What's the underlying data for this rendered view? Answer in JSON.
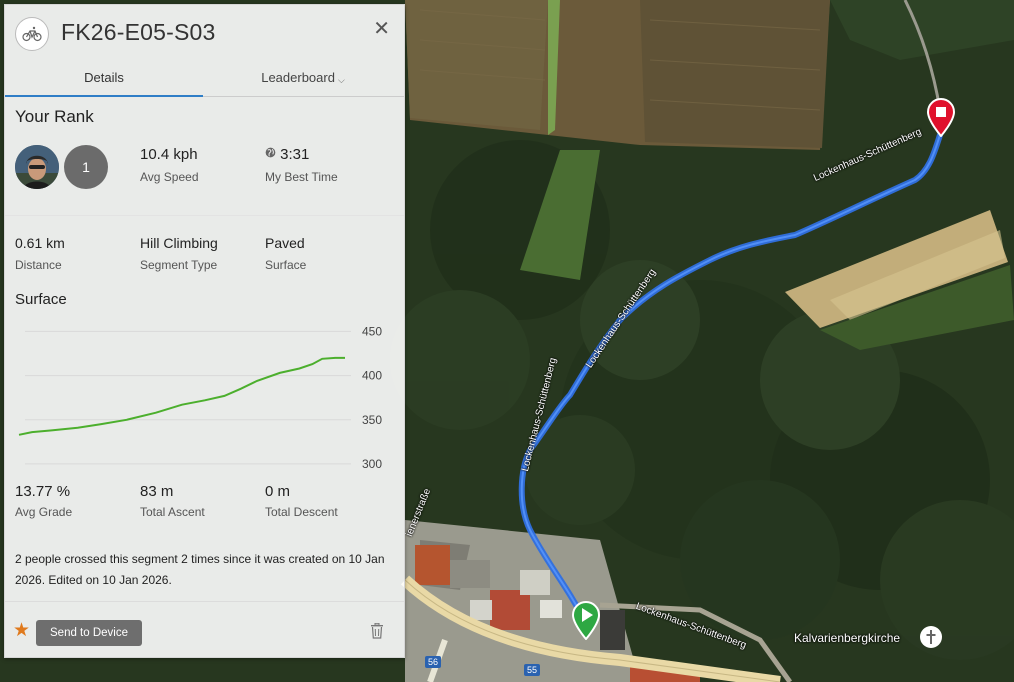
{
  "segment": {
    "title": "FK26-E05-S03",
    "activity_icon": "bicycle-icon",
    "close_icon": "close-icon"
  },
  "tabs": [
    {
      "label": "Details",
      "active": true
    },
    {
      "label": "Leaderboard",
      "active": false,
      "icon": "chevron-down-icon"
    }
  ],
  "rank": {
    "heading": "Your Rank",
    "position": "1",
    "avg_speed": {
      "value": "10.4 kph",
      "label": "Avg Speed"
    },
    "best_time": {
      "value": "3:31",
      "label": "My Best Time",
      "icon": "globe-icon"
    }
  },
  "info": {
    "distance": {
      "value": "0.61 km",
      "label": "Distance"
    },
    "segment_type": {
      "value": "Hill Climbing",
      "label": "Segment Type"
    },
    "surface": {
      "value": "Paved",
      "label": "Surface"
    }
  },
  "surface_heading": "Surface",
  "chart_data": {
    "type": "line",
    "title": "",
    "xlabel": "",
    "ylabel": "",
    "ylim": [
      292,
      455
    ],
    "yticks": [
      "450",
      "400",
      "350",
      "300"
    ],
    "grid": true,
    "axis_side": "right",
    "series": [
      {
        "color": "#4caf2d",
        "x": [
          0,
          0.04,
          0.1,
          0.18,
          0.25,
          0.33,
          0.42,
          0.5,
          0.57,
          0.63,
          0.68,
          0.73,
          0.8,
          0.86,
          0.9,
          0.93,
          0.97,
          1.0
        ],
        "values": [
          333,
          336,
          338,
          341,
          345,
          350,
          358,
          367,
          372,
          377,
          385,
          394,
          403,
          408,
          413,
          419,
          420,
          420
        ]
      }
    ]
  },
  "grade": {
    "avg_grade": {
      "value": "13.77 %",
      "label": "Avg Grade"
    },
    "total_ascent": {
      "value": "83 m",
      "label": "Total Ascent"
    },
    "total_descent": {
      "value": "0 m",
      "label": "Total Descent"
    }
  },
  "description": "2 people crossed this segment 2 times since it was created on 10 Jan 2026. Edited on 10 Jan 2026.",
  "footer": {
    "favorite_icon": "star-icon",
    "send_label": "Send to Device",
    "delete_icon": "trash-icon"
  },
  "map": {
    "route_color": "#3b82f6",
    "street_name": "Lockenhaus-Schüttenberg",
    "landmark": "Kalvarienbergkirche",
    "street_west": "ienerstraße",
    "road_shields": [
      "56",
      "55"
    ],
    "start_marker_icon": "play-marker-icon",
    "end_marker_icon": "stop-marker-icon",
    "landmark_icon": "church-icon"
  }
}
